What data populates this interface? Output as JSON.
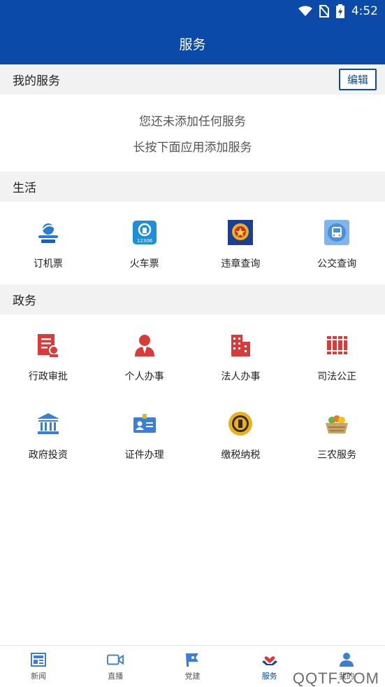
{
  "status_bar": {
    "time": "4:52",
    "icons": [
      "wifi-icon",
      "no-sim-icon",
      "battery-charging-icon"
    ]
  },
  "header": {
    "title": "服务"
  },
  "my_services": {
    "title": "我的服务",
    "edit_label": "编辑",
    "empty_line1": "您还未添加任何服务",
    "empty_line2": "长按下面应用添加服务"
  },
  "life": {
    "title": "生活",
    "items": [
      {
        "label": "订机票",
        "icon": "ctrip-icon"
      },
      {
        "label": "火车票",
        "icon": "train-12306-icon",
        "icon_text": "12306"
      },
      {
        "label": "违章查询",
        "icon": "police-badge-icon"
      },
      {
        "label": "公交查询",
        "icon": "bus-icon"
      }
    ]
  },
  "gov": {
    "title": "政务",
    "items": [
      {
        "label": "行政审批",
        "icon": "approval-document-icon"
      },
      {
        "label": "个人办事",
        "icon": "person-icon"
      },
      {
        "label": "法人办事",
        "icon": "building-icon"
      },
      {
        "label": "司法公正",
        "icon": "law-books-icon"
      },
      {
        "label": "政府投资",
        "icon": "government-building-icon"
      },
      {
        "label": "证件办理",
        "icon": "id-card-icon"
      },
      {
        "label": "缴税纳税",
        "icon": "tax-emblem-icon"
      },
      {
        "label": "三农服务",
        "icon": "produce-basket-icon"
      }
    ]
  },
  "bottom_nav": {
    "items": [
      {
        "label": "新闻",
        "icon": "news-icon"
      },
      {
        "label": "直播",
        "icon": "video-camera-icon"
      },
      {
        "label": "党建",
        "icon": "party-flag-icon"
      },
      {
        "label": "服务",
        "icon": "service-hands-icon",
        "active": true
      },
      {
        "label": "我的",
        "icon": "user-icon"
      }
    ]
  },
  "watermark": "QQTF.COM",
  "colors": {
    "primary": "#0b4aa8",
    "section_bg": "#f2f2f2",
    "gov_red": "#d93a3a"
  }
}
